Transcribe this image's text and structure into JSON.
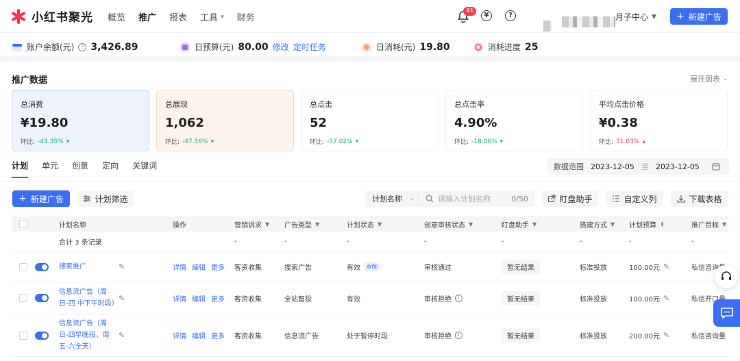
{
  "brand": {
    "name": "小红书聚光"
  },
  "nav": {
    "items": [
      "概览",
      "推广",
      "报表",
      "工具",
      "财务"
    ],
    "active_index": 1
  },
  "header": {
    "notification_count": "41",
    "finance_icon": "¥",
    "help_icon": "?",
    "user_center": "月子中心",
    "new_ad_label": "新建广告"
  },
  "account": {
    "balance_label": "账户余额(元)",
    "balance_value": "3,426.89",
    "daily_budget_label": "日预算(元)",
    "daily_budget_value": "80.00",
    "edit_label": "修改",
    "scheduled_label": "定时任务",
    "daily_spend_label": "日消耗(元)",
    "daily_spend_value": "19.80",
    "progress_label": "消耗进度",
    "progress_value": "25"
  },
  "promo": {
    "title": "推广数据",
    "expand_label": "展开图表",
    "compare_label": "环比:",
    "cards": [
      {
        "label": "总消费",
        "value": "¥19.80",
        "change": "-43.35%",
        "trend": "down"
      },
      {
        "label": "总展现",
        "value": "1,062",
        "change": "-47.56%",
        "trend": "down"
      },
      {
        "label": "总点击",
        "value": "52",
        "change": "-57.02%",
        "trend": "down"
      },
      {
        "label": "总点击率",
        "value": "4.90%",
        "change": "-18.06%",
        "trend": "down"
      },
      {
        "label": "平均点击价格",
        "value": "¥0.38",
        "change": "31.03%",
        "trend": "up"
      }
    ]
  },
  "tabs": {
    "items": [
      "计划",
      "单元",
      "创意",
      "定向",
      "关键词"
    ],
    "active_index": 0
  },
  "date_range": {
    "label": "数据范围",
    "start": "2023-12-05",
    "sep": "至",
    "end": "2023-12-05"
  },
  "toolbar": {
    "new_ad_label": "新建广告",
    "filter_label": "计划筛选",
    "search_field": "计划名称",
    "search_placeholder": "请输入计划名称",
    "search_count": "0/50",
    "assistant_label": "盯盘助手",
    "custom_columns_label": "自定义列",
    "download_label": "下载表格"
  },
  "table": {
    "headers": {
      "name": "计划名称",
      "op": "操作",
      "goal": "营销诉求",
      "type": "广告类型",
      "status": "计划状态",
      "audit": "创意审核状态",
      "ding": "盯盘助手",
      "bid": "搭建方式",
      "budget": "计划预算",
      "target": "推广目标"
    },
    "total_label": "合计 3 条记录",
    "dash": "-",
    "op_labels": {
      "detail": "详情",
      "edit": "编辑",
      "more": "更多"
    },
    "rows": [
      {
        "name": "搜索推广",
        "goal": "客资收集",
        "type": "搜索广告",
        "status": "有效",
        "status_chip": "保",
        "audit": "审核通过",
        "audit_info": false,
        "ding": "暂无结果",
        "bid": "标准投放",
        "budget": "100.00元",
        "target": "私信咨询量"
      },
      {
        "name": "信息流广告（周日-四 中下午时段）",
        "goal": "客资收集",
        "type": "全站智投",
        "status": "有效",
        "status_chip": "",
        "audit": "审核拒绝",
        "audit_info": true,
        "ding": "暂无结果",
        "bid": "标准投放",
        "budget": "100.00元",
        "target": "私信开口量"
      },
      {
        "name": "信息流广告（周日-四早晚段，周五-六全天）",
        "goal": "客资收集",
        "type": "信息流广告",
        "status": "处于暂停时段",
        "status_chip": "",
        "audit": "审核拒绝",
        "audit_info": true,
        "ding": "暂无结果",
        "bid": "标准投放",
        "budget": "200.00元",
        "target": "私信咨询量"
      }
    ]
  },
  "colors": {
    "primary": "#3b6ef5",
    "brand_red": "#ff2e4d",
    "down": "#1db57d",
    "up": "#f24a54"
  },
  "icons": [
    "bell-icon",
    "yuan-icon",
    "help-icon",
    "search-icon",
    "filter-icon",
    "external-link-icon",
    "columns-icon",
    "download-icon",
    "calendar-icon",
    "edit-icon",
    "headset-icon",
    "chat-icon"
  ]
}
